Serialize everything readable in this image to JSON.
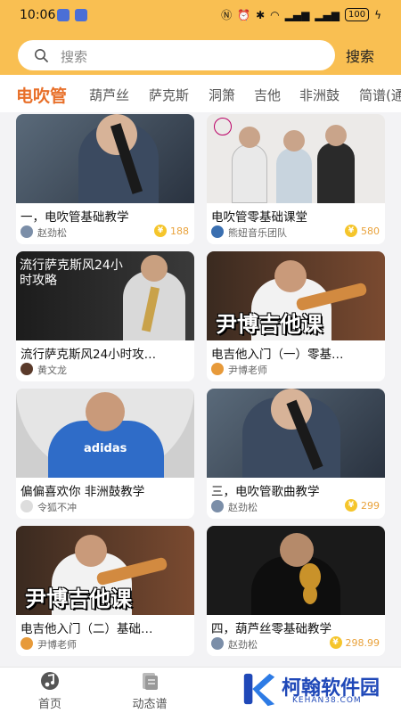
{
  "status_bar": {
    "time": "10:06",
    "battery": "100"
  },
  "search": {
    "placeholder": "搜索",
    "button_label": "搜索"
  },
  "tabs": [
    {
      "label": "电吹管",
      "active": true
    },
    {
      "label": "葫芦丝"
    },
    {
      "label": "萨克斯"
    },
    {
      "label": "洞箫"
    },
    {
      "label": "吉他"
    },
    {
      "label": "非洲鼓"
    },
    {
      "label": "简谱(通"
    }
  ],
  "cards": [
    {
      "title": "一，电吹管基础教学",
      "author": "赵劲松",
      "price": "188"
    },
    {
      "title": "电吹管零基础课堂",
      "author": "熊妞音乐团队",
      "price": "580"
    },
    {
      "title": "流行萨克斯风24小时攻…",
      "author": "黄文龙",
      "overlay": "流行萨克斯风24小\n时攻略"
    },
    {
      "title": "电吉他入门（一）零基…",
      "author": "尹博老师",
      "overlay": "尹博吉他课"
    },
    {
      "title": "偏偏喜欢你 非洲鼓教学",
      "author": "令狐不冲"
    },
    {
      "title": "三，电吹管歌曲教学",
      "author": "赵劲松",
      "price": "299"
    },
    {
      "title": "电吉他入门（二）基础…",
      "author": "尹博老师",
      "overlay": "尹博吉他课"
    },
    {
      "title": "四，葫芦丝零基础教学",
      "author": "赵劲松",
      "price": "298.99"
    }
  ],
  "bottom_nav": [
    {
      "label": "首页",
      "icon": "music-note-icon"
    },
    {
      "label": "动态谱",
      "icon": "sheet-icon"
    }
  ],
  "watermark": {
    "main": "柯翰软件园",
    "sub": "KEHAN38.COM"
  },
  "colors": {
    "header": "#f9bf52",
    "accent": "#e8702a",
    "price": "#e9a23b"
  }
}
